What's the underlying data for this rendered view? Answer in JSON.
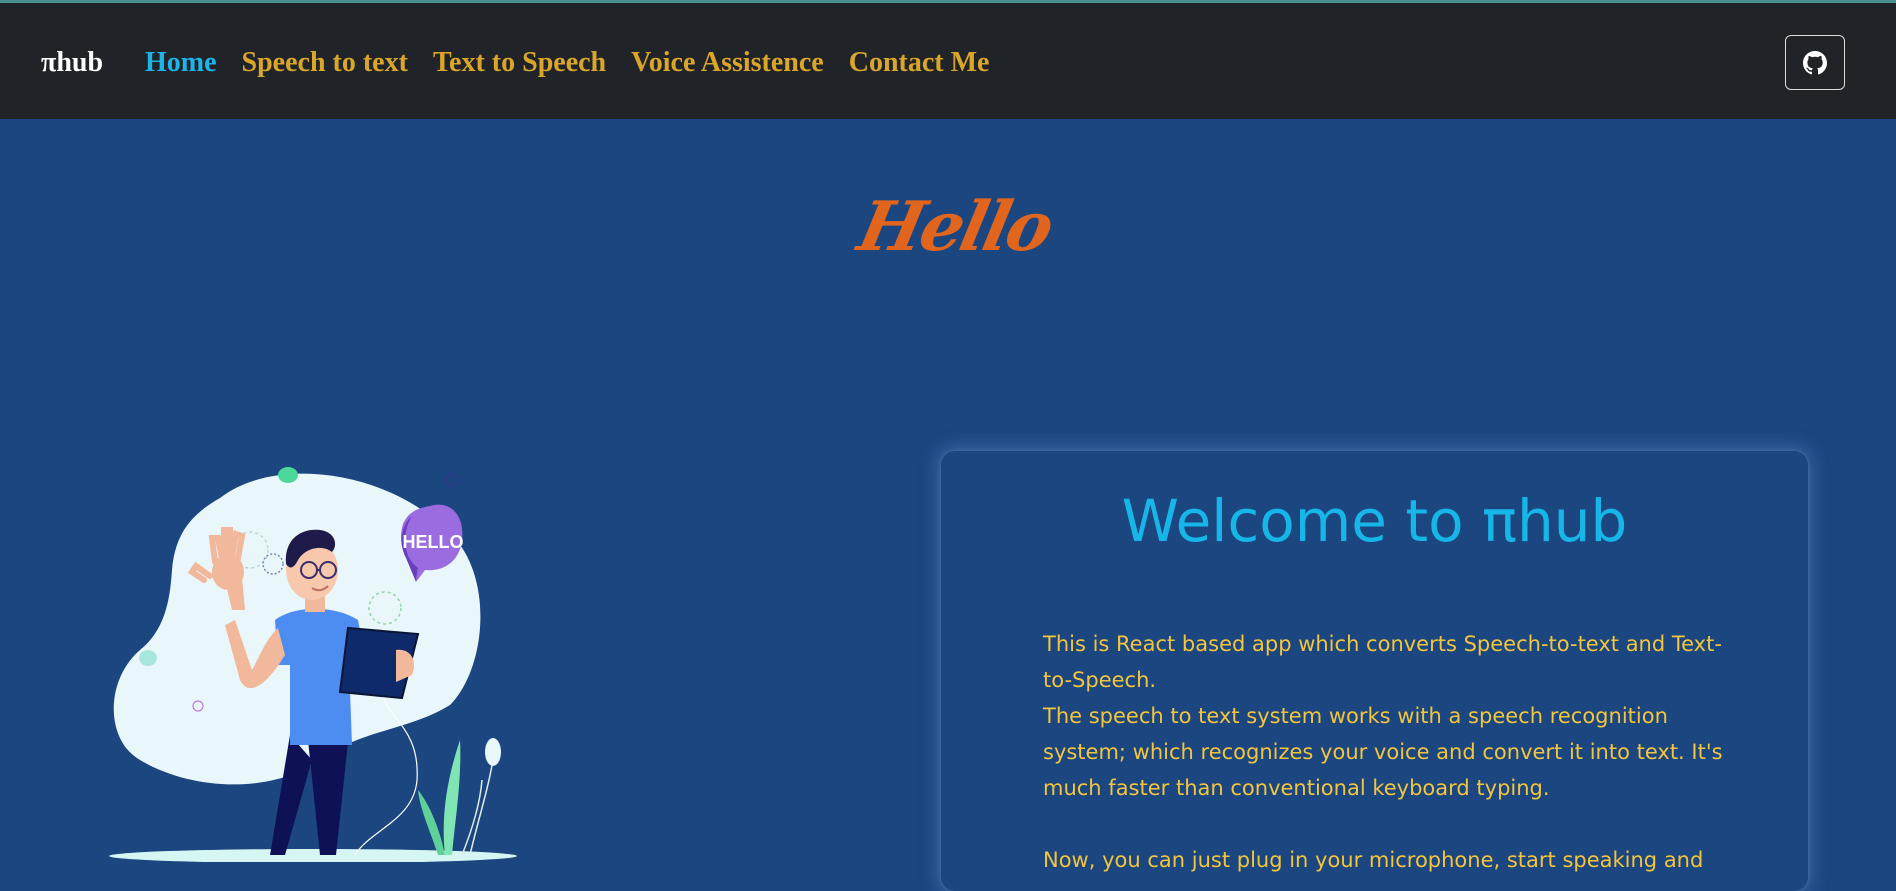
{
  "navbar": {
    "brand": "πhub",
    "links": [
      {
        "label": "Home",
        "active": true
      },
      {
        "label": "Speech to text",
        "active": false
      },
      {
        "label": "Text to Speech",
        "active": false
      },
      {
        "label": "Voice Assistence",
        "active": false
      },
      {
        "label": "Contact Me",
        "active": false
      }
    ],
    "github_icon": "github-icon"
  },
  "hero": {
    "greeting": "Hello",
    "illustration_badge": "HELLO"
  },
  "card": {
    "title": "Welcome to πhub",
    "paragraphs": [
      "This is React based app which converts Speech-to-text and Text-to-Speech.",
      "The speech to text system works with a speech recognition system; which recognizes your voice and convert it into text. It's much faster than conventional keyboard typing.",
      "Now, you can just plug in your microphone, start speaking and"
    ]
  },
  "colors": {
    "background": "#1b4680",
    "navbar": "#202328",
    "nav_link": "#d9a62a",
    "nav_active": "#1bb5e8",
    "greeting": "#e2651e",
    "card_title": "#17b6e8",
    "card_text": "#f2c53d"
  }
}
